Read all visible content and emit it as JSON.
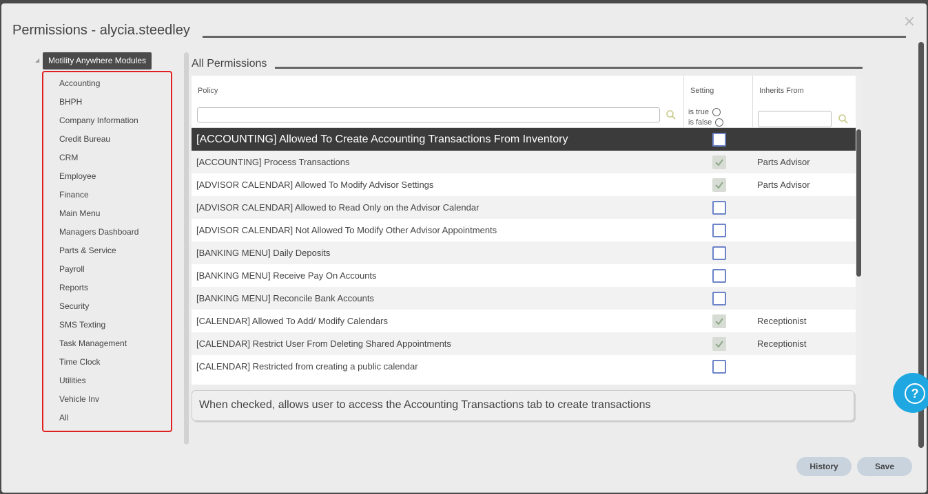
{
  "dialog": {
    "title": "Permissions - alycia.steedley",
    "close_label": "×"
  },
  "tree": {
    "root_label": "Motility Anywhere Modules",
    "items": [
      "Accounting",
      "BHPH",
      "Company Information",
      "Credit Bureau",
      "CRM",
      "Employee",
      "Finance",
      "Main Menu",
      "Managers Dashboard",
      "Parts & Service",
      "Payroll",
      "Reports",
      "Security",
      "SMS Texting",
      "Task Management",
      "Time Clock",
      "Utilities",
      "Vehicle Inv",
      "All"
    ]
  },
  "permissions": {
    "section_title": "All Permissions",
    "columns": {
      "policy": "Policy",
      "setting": "Setting",
      "inherits_from": "Inherits From"
    },
    "setting_filter": {
      "is_true": "is true",
      "is_false": "is false"
    },
    "rows": [
      {
        "policy": "[ACCOUNTING] Allowed To Create Accounting Transactions From Inventory",
        "checked": false,
        "inherits_from": "",
        "selected": true
      },
      {
        "policy": "[ACCOUNTING] Process Transactions",
        "checked": true,
        "inherits_from": "Parts Advisor"
      },
      {
        "policy": "[ADVISOR CALENDAR] Allowed To Modify Advisor Settings",
        "checked": true,
        "inherits_from": "Parts Advisor"
      },
      {
        "policy": "[ADVISOR CALENDAR] Allowed to Read Only on the Advisor Calendar",
        "checked": false,
        "inherits_from": ""
      },
      {
        "policy": "[ADVISOR CALENDAR] Not Allowed To Modify Other Advisor Appointments",
        "checked": false,
        "inherits_from": ""
      },
      {
        "policy": "[BANKING MENU] Daily Deposits",
        "checked": false,
        "inherits_from": ""
      },
      {
        "policy": "[BANKING MENU] Receive Pay On Accounts",
        "checked": false,
        "inherits_from": ""
      },
      {
        "policy": "[BANKING MENU] Reconcile Bank Accounts",
        "checked": false,
        "inherits_from": ""
      },
      {
        "policy": "[CALENDAR] Allowed To Add/ Modify Calendars",
        "checked": true,
        "inherits_from": "Receptionist"
      },
      {
        "policy": "[CALENDAR] Restrict User From Deleting Shared Appointments",
        "checked": true,
        "inherits_from": "Receptionist"
      },
      {
        "policy": "[CALENDAR] Restricted from creating a public calendar",
        "checked": false,
        "inherits_from": ""
      }
    ],
    "description": "When checked, allows user to access the Accounting Transactions tab to create transactions"
  },
  "buttons": {
    "history": "History",
    "save": "Save"
  },
  "help": {
    "label": "?"
  },
  "colors": {
    "accent_blue": "#1ea7e0",
    "highlight_red": "#e02020",
    "selected_row": "#3b3b3b",
    "button_bg": "#c8d3de"
  }
}
